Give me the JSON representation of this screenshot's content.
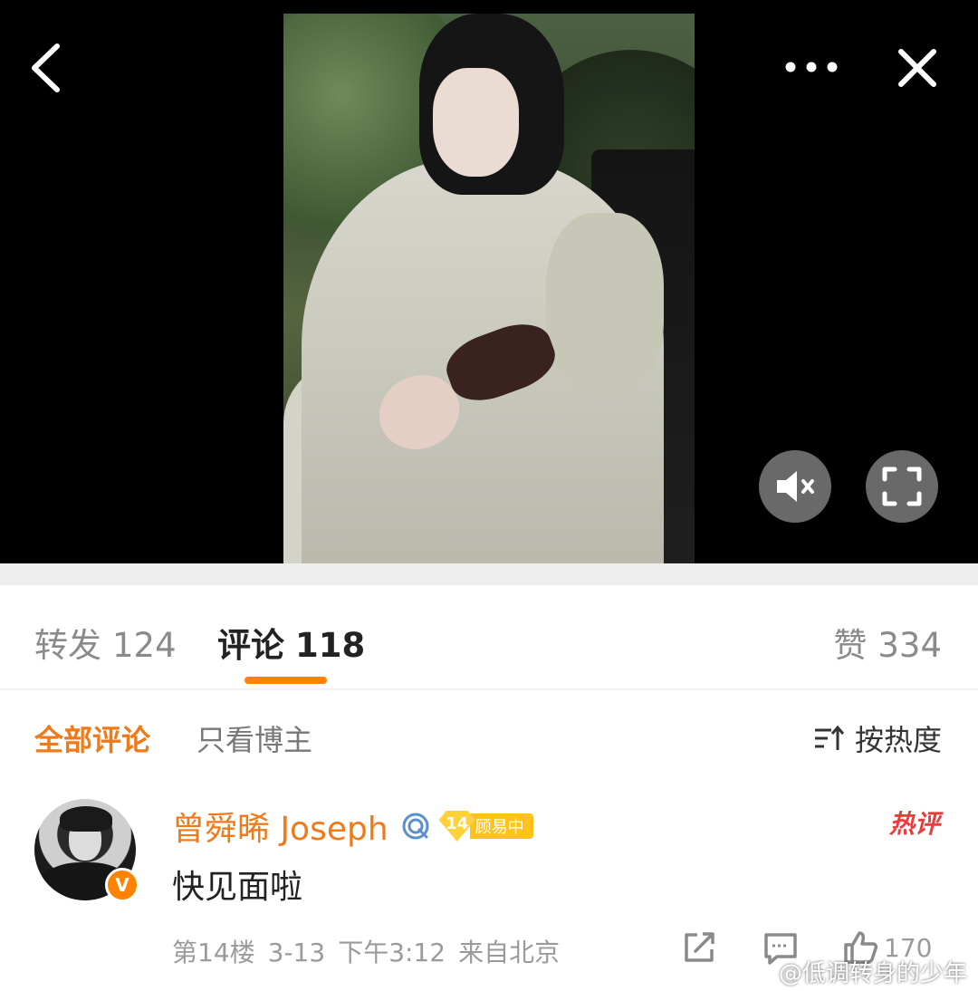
{
  "tabs": {
    "repost": {
      "label": "转发",
      "count": "124"
    },
    "comments": {
      "label": "评论",
      "count": "118"
    },
    "likes": {
      "label": "赞",
      "count": "334"
    }
  },
  "filters": {
    "all": "全部评论",
    "owner_only": "只看博主",
    "sort": "按热度"
  },
  "comment": {
    "username": "曾舜晞 Joseph",
    "level": "14",
    "level_label": "顾易中",
    "hot_label": "热评",
    "verified": "V",
    "text": "快见面啦",
    "floor": "第14楼",
    "date": "3-13",
    "time": "下午3:12",
    "location": "来自北京",
    "like_count": "170"
  },
  "watermark": "@低调转身的少年",
  "colors": {
    "accent": "#ff8200",
    "username": "#f07a1a",
    "hot": "#ec3b3b",
    "level_badge": "#ffc21a"
  },
  "icons": [
    "back-arrow-icon",
    "more-dots-icon",
    "close-icon",
    "mute-icon",
    "fullscreen-icon",
    "sort-icon",
    "member-icon",
    "share-icon",
    "reply-icon",
    "like-icon",
    "weibo-logo-icon"
  ]
}
